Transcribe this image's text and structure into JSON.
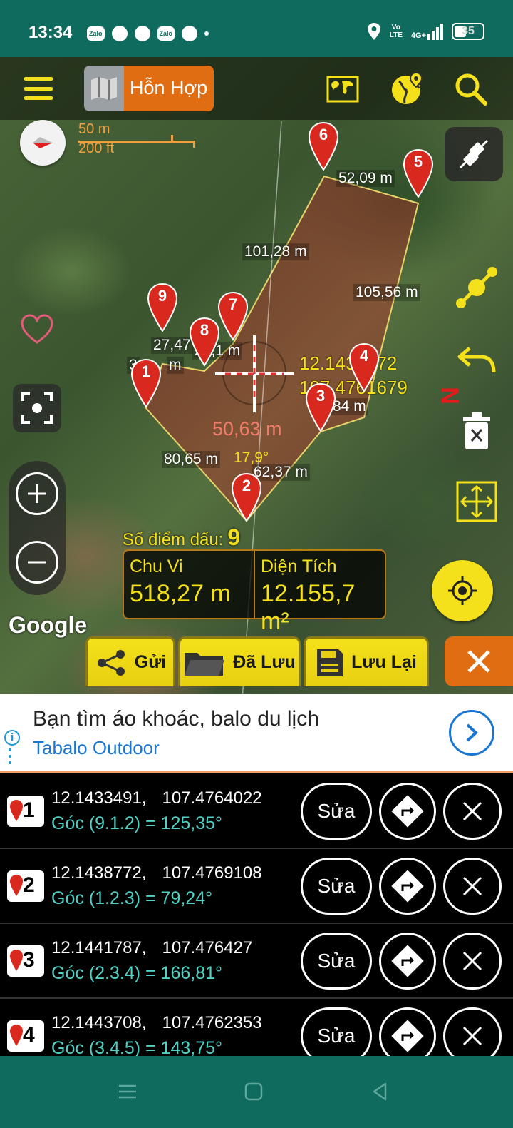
{
  "status_bar": {
    "time": "13:34",
    "notification_apps": [
      "Zalo",
      "messenger",
      "messenger",
      "Zalo",
      "messenger"
    ],
    "volte_line1": "Vo",
    "volte_line2": "LTE",
    "network": "4G+",
    "battery": "35"
  },
  "toolbar": {
    "map_type_label": "Hỗn Hợp"
  },
  "scale": {
    "metric": "50 m",
    "imperial": "200 ft"
  },
  "measurement": {
    "segments": [
      "52,09 m",
      "101,28 m",
      "105,56 m",
      "27,47",
      "20,1 m",
      "3",
      "m",
      "84 m",
      "80,65 m",
      "62,37 m"
    ],
    "points": [
      "1",
      "2",
      "3",
      "4",
      "5",
      "6",
      "7",
      "8",
      "9"
    ],
    "crosshair_lat": "12.1438372",
    "crosshair_lng": "107.4761679",
    "crosshair_distance": "50,63 m",
    "crosshair_angle": "17,9°",
    "north_label": "N",
    "point_count_label": "Số điểm dấu:",
    "point_count": "9",
    "perimeter_label": "Chu Vi",
    "perimeter_value": "518,27 m",
    "area_label": "Diện Tích",
    "area_value": "12.155,7 m²"
  },
  "map_attribution": "Google",
  "actions": {
    "send": "Gửi",
    "saved": "Đã Lưu",
    "save": "Lưu Lại"
  },
  "ad": {
    "title": "Bạn tìm áo khoác, balo du lịch",
    "advertiser": "Tabalo Outdoor",
    "info": "i"
  },
  "points_list": [
    {
      "index": "1",
      "lat": "12.1433491,",
      "lng": "107.4764022",
      "angle": "Góc (9.1.2) = 125,35°",
      "edit": "Sửa"
    },
    {
      "index": "2",
      "lat": "12.1438772,",
      "lng": "107.4769108",
      "angle": "Góc (1.2.3) = 79,24°",
      "edit": "Sửa"
    },
    {
      "index": "3",
      "lat": "12.1441787,",
      "lng": "107.476427",
      "angle": "Góc (2.3.4) = 166,81°",
      "edit": "Sửa"
    },
    {
      "index": "4",
      "lat": "12.1443708,",
      "lng": "107.4762353",
      "angle": "Góc (3.4.5) = 143,75°",
      "edit": "Sửa"
    }
  ],
  "colors": {
    "status_bar": "#0f6b5e",
    "accent_yellow": "#f5e11b",
    "accent_orange": "#e06d12",
    "marker_red": "#d9281e",
    "angle_text": "#4fd1c5"
  }
}
